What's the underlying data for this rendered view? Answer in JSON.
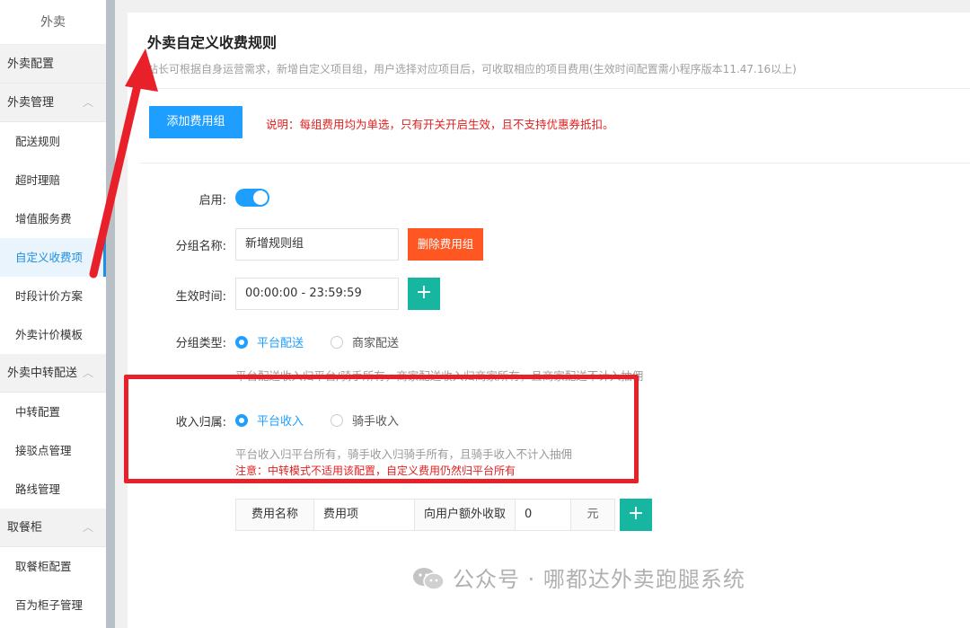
{
  "sidebar": {
    "header": "外卖",
    "groups": [
      {
        "label": "外卖配置",
        "items": []
      },
      {
        "label": "外卖管理",
        "items": [
          "配送规则",
          "超时理赔",
          "增值服务费",
          "自定义收费项",
          "时段计价方案",
          "外卖计价模板"
        ]
      },
      {
        "label": "外卖中转配送",
        "items": [
          "中转配置",
          "接驳点管理",
          "路线管理"
        ]
      },
      {
        "label": "取餐柜",
        "items": [
          "取餐柜配置",
          "百为柜子管理"
        ]
      }
    ],
    "active_item": "自定义收费项"
  },
  "page": {
    "title": "外卖自定义收费规则",
    "description": "站长可根据自身运营需求，新增自定义项目组，用户选择对应项目后，可收取相应的项目费用(生效时间配置需小程序版本11.47.16以上)",
    "add_button": "添加费用组",
    "note": "说明：每组费用均为单选，只有开关开启生效，且不支持优惠券抵扣。"
  },
  "form": {
    "enable_label": "启用:",
    "enabled": true,
    "group_name_label": "分组名称:",
    "group_name_value": "新增规则组",
    "delete_button": "删除费用组",
    "time_label": "生效时间:",
    "time_value": "00:00:00 - 23:59:59",
    "plus": "+",
    "type_label": "分组类型:",
    "type_options": [
      "平台配送",
      "商家配送"
    ],
    "type_selected": "平台配送",
    "type_hint": "平台配送收入归平台/骑手所有，商家配送收入归商家所有，且商家配送不计入抽佣",
    "income_label": "收入归属:",
    "income_options": [
      "平台收入",
      "骑手收入"
    ],
    "income_selected": "平台收入",
    "income_hint": "平台收入归平台所有，骑手收入归骑手所有，且骑手收入不计入抽佣",
    "income_warning": "注意：中转模式不适用该配置，自定义费用仍然归平台所有",
    "fee": {
      "name_label": "费用名称",
      "name_value": "费用项",
      "charge_label": "向用户额外收取",
      "charge_value": "0",
      "unit": "元"
    }
  },
  "watermark": "公众号 · 哪都达外卖跑腿系统",
  "colors": {
    "primary": "#1e9fff",
    "danger": "#ff5722",
    "teal": "#16b6a0",
    "annotation_red": "#e8202a"
  }
}
